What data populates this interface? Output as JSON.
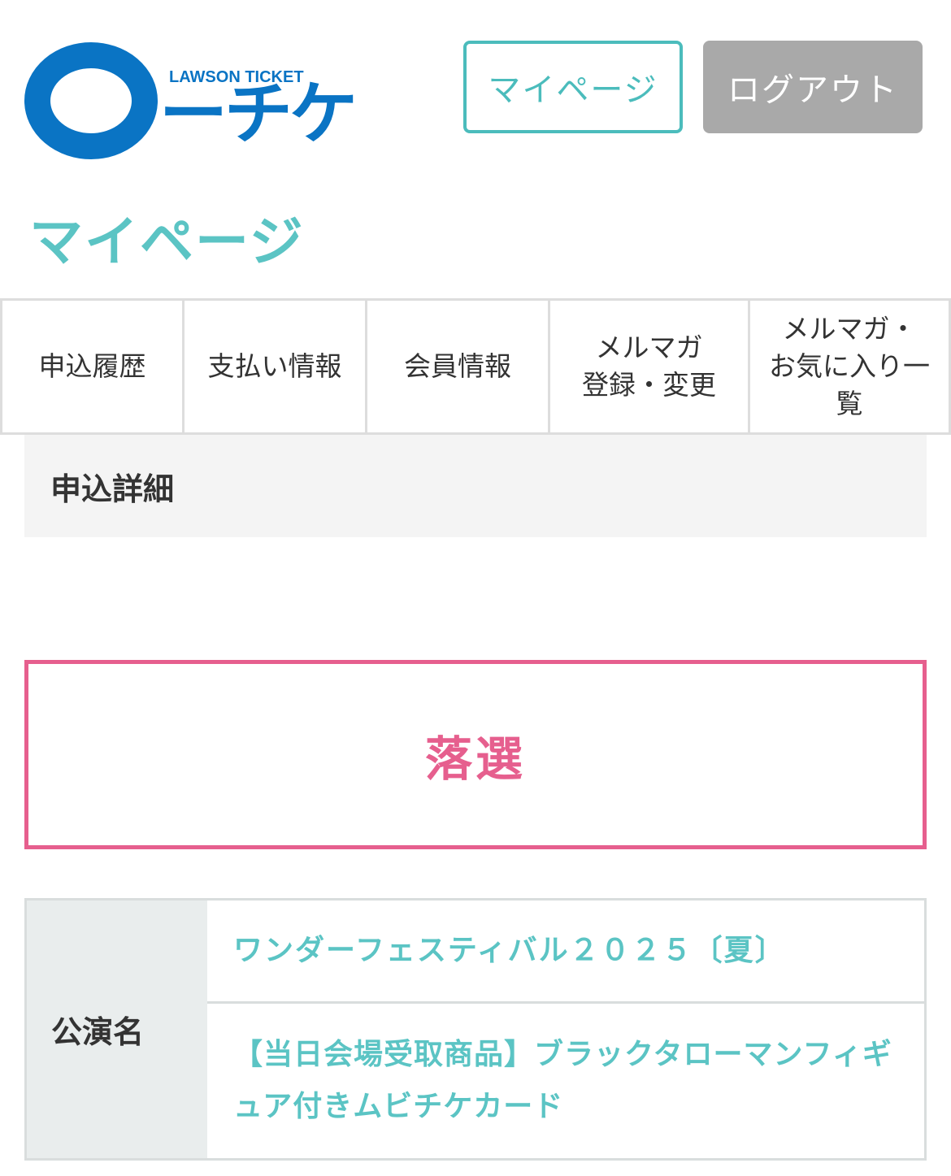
{
  "header": {
    "logo": {
      "sub_text": "LAWSON TICKET",
      "main_text": "ーチケ"
    },
    "mypage_button": "マイページ",
    "logout_button": "ログアウト"
  },
  "page_title": "マイページ",
  "nav": {
    "tabs": [
      {
        "label_lines": [
          "申込履歴"
        ]
      },
      {
        "label_lines": [
          "支払い情報"
        ]
      },
      {
        "label_lines": [
          "会員情報"
        ]
      },
      {
        "label_lines": [
          "メルマガ",
          "登録・変更"
        ]
      },
      {
        "label_lines": [
          "メルマガ・",
          "お気に入り一",
          "覧"
        ]
      }
    ]
  },
  "section_heading": "申込詳細",
  "result": {
    "status": "落選"
  },
  "details": {
    "performance_label": "公演名",
    "performance_name": "ワンダーフェスティバル２０２５〔夏〕",
    "product_name": "【当日会場受取商品】ブラックタローマンフィギュア付きムビチケカード"
  },
  "colors": {
    "brand_blue": "#0a74c4",
    "teal": "#5bc4c4",
    "button_teal": "#4bbcbc",
    "logout_gray": "#a9a9a9",
    "result_pink": "#e65f8e"
  }
}
